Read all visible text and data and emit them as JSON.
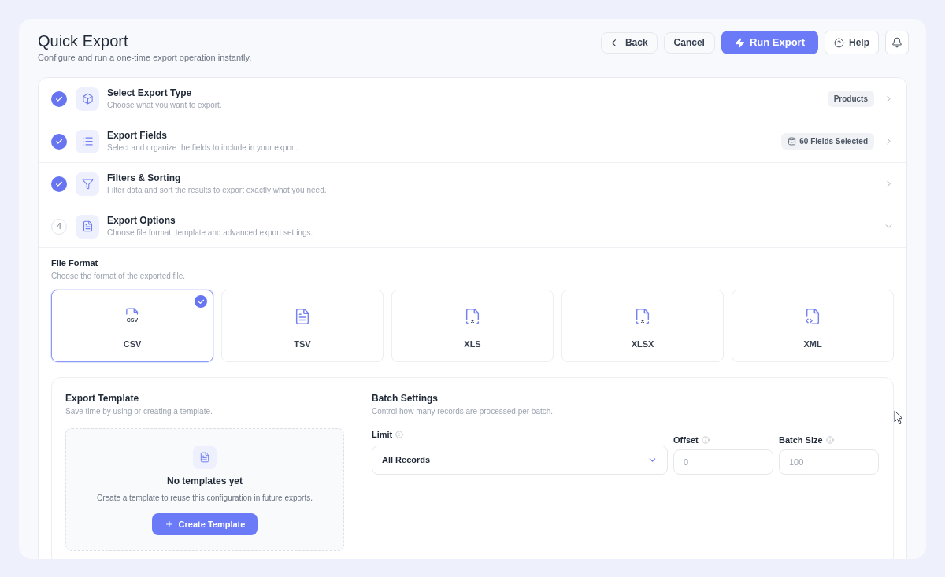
{
  "header": {
    "title": "Quick Export",
    "subtitle": "Configure and run a one-time export operation instantly."
  },
  "actions": [
    {
      "kind": "back",
      "label": "Back"
    },
    {
      "kind": "plain",
      "label": "Cancel"
    },
    {
      "kind": "primary",
      "label": "Run Export"
    },
    {
      "kind": "help",
      "label": "Help"
    },
    {
      "kind": "notifications"
    }
  ],
  "steps": [
    {
      "kind": "type",
      "title": "Select Export Type",
      "description": "Choose what you want to export.",
      "completed": true,
      "expanded": false,
      "badge": {
        "kind": "plain",
        "text": "Products"
      }
    },
    {
      "kind": "fields",
      "title": "Export Fields",
      "description": "Select and organize the fields to include in your export.",
      "completed": true,
      "expanded": false,
      "badge": {
        "kind": "fields",
        "text": "60 Fields Selected"
      }
    },
    {
      "kind": "filters",
      "title": "Filters & Sorting",
      "description": "Filter data and sort the results to export exactly what you need.",
      "completed": true,
      "expanded": false
    },
    {
      "kind": "options",
      "number": "4",
      "title": "Export Options",
      "description": "Choose file format, template and advanced export settings.",
      "completed": false,
      "expanded": true,
      "file_format": {
        "title": "File Format",
        "description": "Choose the format of the exported file.",
        "formats": [
          {
            "kind": "csv",
            "label": "CSV",
            "icon_label": "CSV",
            "selected": true
          },
          {
            "kind": "tsv",
            "label": "TSV",
            "selected": false
          },
          {
            "kind": "xls",
            "label": "XLS",
            "selected": false
          },
          {
            "kind": "xlsx",
            "label": "XLSX",
            "selected": false
          },
          {
            "kind": "xml",
            "label": "XML",
            "selected": false
          }
        ]
      },
      "export_template": {
        "title": "Export Template",
        "description": "Save time by using or creating a template.",
        "empty_state": {
          "title": "No templates yet",
          "description": "Create a template to reuse this configuration in future exports.",
          "button": "Create Template"
        }
      },
      "batch_settings": {
        "title": "Batch Settings",
        "description": "Control how many records are processed per batch.",
        "fields": [
          {
            "kind": "select",
            "label": "Limit",
            "value": "All Records"
          },
          {
            "kind": "input",
            "label": "Offset",
            "placeholder": "0"
          },
          {
            "kind": "input",
            "label": "Batch Size",
            "placeholder": "100"
          }
        ]
      }
    }
  ]
}
